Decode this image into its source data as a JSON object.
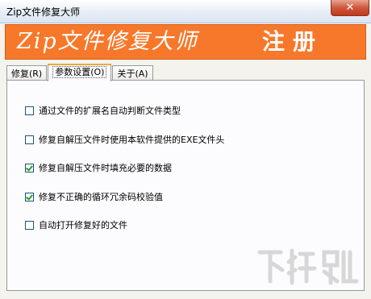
{
  "window": {
    "title": "Zip文件修复大师",
    "close_label": "✕"
  },
  "banner": {
    "app_name": "Zip文件修复大师",
    "register_label": "注册"
  },
  "tabs": [
    {
      "label": "修复(R)"
    },
    {
      "label": "参数设置(O)"
    },
    {
      "label": "关于(A)"
    }
  ],
  "active_tab": 1,
  "options": [
    {
      "label": "通过文件的扩展名自动判断文件类型",
      "checked": false
    },
    {
      "label": "修复自解压文件时使用本软件提供的EXE文件头",
      "checked": false
    },
    {
      "label": "修复自解压文件时填充必要的数据",
      "checked": true
    },
    {
      "label": "修复不正确的循环冗余码校验值",
      "checked": true
    },
    {
      "label": "自动打开修复好的文件",
      "checked": false
    }
  ],
  "watermark": {
    "text": "下载吧"
  },
  "colors": {
    "banner": "#f7782a",
    "check": "#21a121"
  }
}
